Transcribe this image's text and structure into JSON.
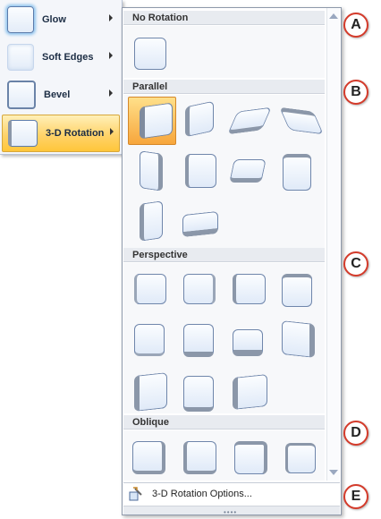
{
  "menu": {
    "items": [
      {
        "label": "Glow"
      },
      {
        "label": "Soft Edges"
      },
      {
        "label": "Bevel"
      },
      {
        "label": "3-D Rotation"
      }
    ]
  },
  "gallery": {
    "sections": [
      {
        "title": "No Rotation"
      },
      {
        "title": "Parallel"
      },
      {
        "title": "Perspective"
      },
      {
        "title": "Oblique"
      }
    ],
    "footer_option": "3-D Rotation Options..."
  },
  "callouts": [
    "A",
    "B",
    "C",
    "D",
    "E"
  ],
  "colors": {
    "selected_fill": "#f7a63c",
    "callout_border": "#d43b2b",
    "shape_border": "#6f86ab"
  }
}
